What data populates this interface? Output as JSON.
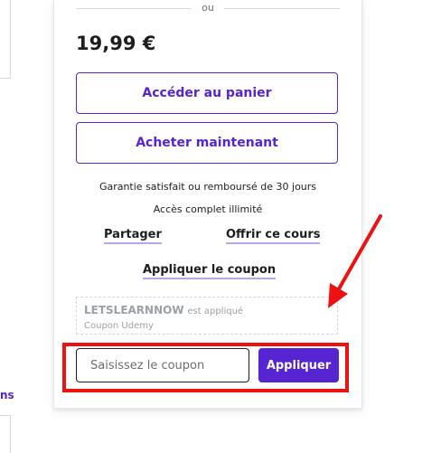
{
  "left": {
    "link_fragment": "ns"
  },
  "card": {
    "divider_label": "ou",
    "price": "19,99 €",
    "add_to_cart_label": "Accéder au panier",
    "buy_now_label": "Acheter maintenant",
    "guarantee_text": "Garantie satisfait ou remboursé de 30 jours",
    "access_text": "Accès complet illimité",
    "share_label": "Partager",
    "gift_label": "Offrir ce cours",
    "apply_coupon_link": "Appliquer le coupon",
    "applied_coupon": {
      "code": "LETSLEARNNOW",
      "status": "est appliqué",
      "source": "Coupon Udemy"
    },
    "coupon_input": {
      "placeholder": "Saisissez le coupon",
      "value": ""
    },
    "apply_button_label": "Appliquer"
  },
  "annotation": {
    "highlight_color": "#ee1111",
    "arrow_color": "#ee1111"
  },
  "colors": {
    "accent": "#5624d0",
    "text": "#1c1d1f"
  }
}
